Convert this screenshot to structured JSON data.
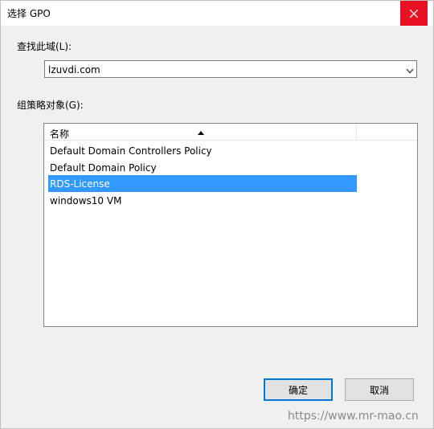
{
  "window": {
    "title": "选择 GPO",
    "close_icon": "close-icon"
  },
  "domain": {
    "label": "查找此域(L):",
    "selected": "lzuvdi.com"
  },
  "gpo": {
    "label": "组策略对象(G):",
    "column_header": "名称",
    "items": [
      {
        "name": "Default Domain Controllers Policy",
        "selected": false
      },
      {
        "name": "Default Domain Policy",
        "selected": false
      },
      {
        "name": "RDS-License",
        "selected": true
      },
      {
        "name": "windows10 VM",
        "selected": false
      }
    ]
  },
  "buttons": {
    "ok": "确定",
    "cancel": "取消"
  },
  "watermark": "https://www.mr-mao.cn",
  "colors": {
    "close_bg": "#e81123",
    "selection": "#3399ff",
    "default_button_border": "#0078d7"
  }
}
